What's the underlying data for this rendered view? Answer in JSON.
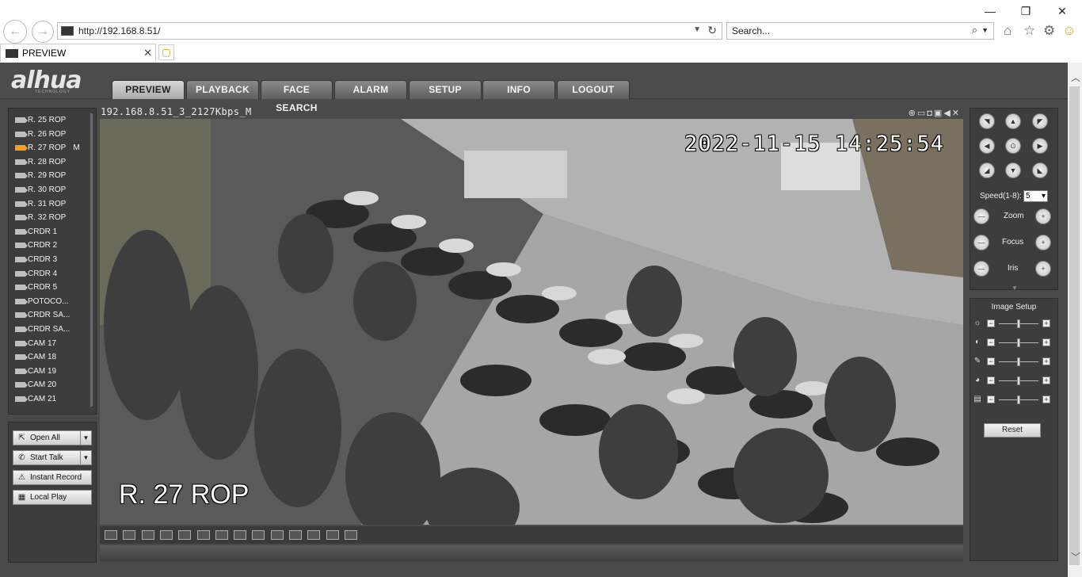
{
  "browser": {
    "url": "http://192.168.8.51/",
    "search_placeholder": "Search...",
    "tab_title": "PREVIEW",
    "window_controls": {
      "minimize": "—",
      "restore": "❐",
      "close": "✕"
    },
    "icons": [
      "back-icon",
      "forward-icon",
      "home-icon",
      "star-icon",
      "gear-icon",
      "smiley-icon"
    ]
  },
  "app": {
    "logo": "alhua",
    "logo_sub": "TECHNOLOGY",
    "menu": [
      "PREVIEW",
      "PLAYBACK",
      "FACE SEARCH",
      "ALARM",
      "SETUP",
      "INFO",
      "LOGOUT"
    ],
    "active_menu": "PREVIEW"
  },
  "channels": [
    {
      "label": "R. 25 ROP"
    },
    {
      "label": "R. 26 ROP"
    },
    {
      "label": "R. 27 ROP",
      "active": true,
      "mark": "M"
    },
    {
      "label": "R. 28 ROP"
    },
    {
      "label": "R. 29 ROP"
    },
    {
      "label": "R. 30 ROP"
    },
    {
      "label": "R. 31 ROP"
    },
    {
      "label": "R. 32 ROP"
    },
    {
      "label": "CRDR 1"
    },
    {
      "label": "CRDR 2"
    },
    {
      "label": "CRDR 3"
    },
    {
      "label": "CRDR 4"
    },
    {
      "label": "CRDR 5"
    },
    {
      "label": "POTOCO..."
    },
    {
      "label": "CRDR SA..."
    },
    {
      "label": "CRDR SA..."
    },
    {
      "label": "CAM 17"
    },
    {
      "label": "CAM 18"
    },
    {
      "label": "CAM 19"
    },
    {
      "label": "CAM 20"
    },
    {
      "label": "CAM 21"
    }
  ],
  "controls": {
    "open_all": "Open All",
    "start_talk": "Start Talk",
    "instant_record": "Instant Record",
    "local_play": "Local Play"
  },
  "video": {
    "stream_title": "192.168.8.51_3_2127Kbps_M",
    "timestamp": "2022-11-15 14:25:54",
    "channel_name": "R. 27 ROP"
  },
  "layout_buttons": [
    "1:1",
    "fit",
    "full",
    "wide",
    "1",
    "4",
    "6",
    "8",
    "9",
    "13",
    "16",
    "20",
    "25",
    "36"
  ],
  "ptz": {
    "speed_label": "Speed(1-8):",
    "speed_value": "5",
    "zoom_label": "Zoom",
    "focus_label": "Focus",
    "iris_label": "Iris"
  },
  "image_setup": {
    "title": "Image Setup",
    "rows": [
      {
        "icon": "☼",
        "name": "brightness",
        "level": 0.5
      },
      {
        "icon": "◐",
        "name": "contrast",
        "level": 0.5
      },
      {
        "icon": "✎",
        "name": "saturation",
        "level": 0.5
      },
      {
        "icon": "◕",
        "name": "hue",
        "level": 0.5
      },
      {
        "icon": "▤",
        "name": "sharpness",
        "level": 0.5
      }
    ],
    "reset": "Reset"
  }
}
